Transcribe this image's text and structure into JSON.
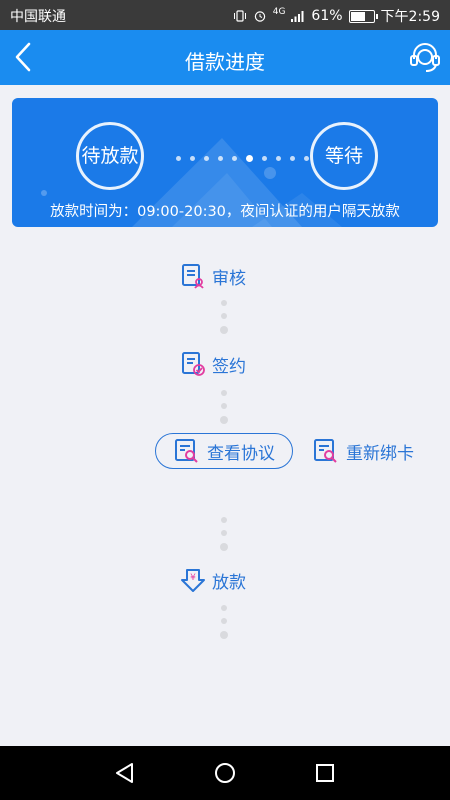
{
  "status_bar": {
    "carrier": "中国联通",
    "network": "4G",
    "battery_percent": "61%",
    "time": "下午2:59"
  },
  "header": {
    "title": "借款进度",
    "back_icon": "chevron-left-icon",
    "support_icon": "headset-icon"
  },
  "progress_card": {
    "left_status": "待放款",
    "right_status": "等待",
    "note": "放款时间为：09:00-20:30，夜间认证的用户隔天放款"
  },
  "steps": {
    "review": "审核",
    "sign": "签约",
    "view_agreement": "查看协议",
    "rebind_card": "重新绑卡",
    "disburse": "放款"
  },
  "colors": {
    "header": "#1a8cf0",
    "card": "#1b7ae8",
    "accent_text": "#2a75d6",
    "background": "#f0f1f6",
    "icon_pink": "#e23da0"
  }
}
